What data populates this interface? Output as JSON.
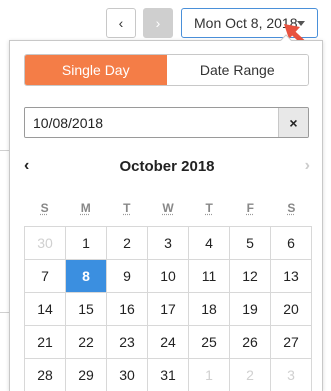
{
  "toolbar": {
    "prev_label": "‹",
    "next_label": "›",
    "date_display": "Mon Oct 8, 2018"
  },
  "picker": {
    "modes": [
      {
        "label": "Single Day",
        "active": true
      },
      {
        "label": "Date Range",
        "active": false
      }
    ],
    "input_value": "10/08/2018",
    "clear_label": "×",
    "month_title": "October 2018",
    "prev_month": "‹",
    "next_month": "›",
    "weekdays": [
      "S",
      "M",
      "T",
      "W",
      "T",
      "F",
      "S"
    ],
    "days": [
      {
        "n": "30",
        "muted": true
      },
      {
        "n": "1"
      },
      {
        "n": "2"
      },
      {
        "n": "3"
      },
      {
        "n": "4"
      },
      {
        "n": "5"
      },
      {
        "n": "6"
      },
      {
        "n": "7"
      },
      {
        "n": "8",
        "selected": true
      },
      {
        "n": "9"
      },
      {
        "n": "10"
      },
      {
        "n": "11"
      },
      {
        "n": "12"
      },
      {
        "n": "13"
      },
      {
        "n": "14"
      },
      {
        "n": "15"
      },
      {
        "n": "16"
      },
      {
        "n": "17"
      },
      {
        "n": "18"
      },
      {
        "n": "19"
      },
      {
        "n": "20"
      },
      {
        "n": "21"
      },
      {
        "n": "22"
      },
      {
        "n": "23"
      },
      {
        "n": "24"
      },
      {
        "n": "25"
      },
      {
        "n": "26"
      },
      {
        "n": "27"
      },
      {
        "n": "28"
      },
      {
        "n": "29"
      },
      {
        "n": "30"
      },
      {
        "n": "31"
      },
      {
        "n": "1",
        "muted": true
      },
      {
        "n": "2",
        "muted": true
      },
      {
        "n": "3",
        "muted": true
      }
    ]
  },
  "colors": {
    "accent": "#f47d47",
    "selected": "#3b8fe0",
    "arrow": "#e8523f"
  }
}
